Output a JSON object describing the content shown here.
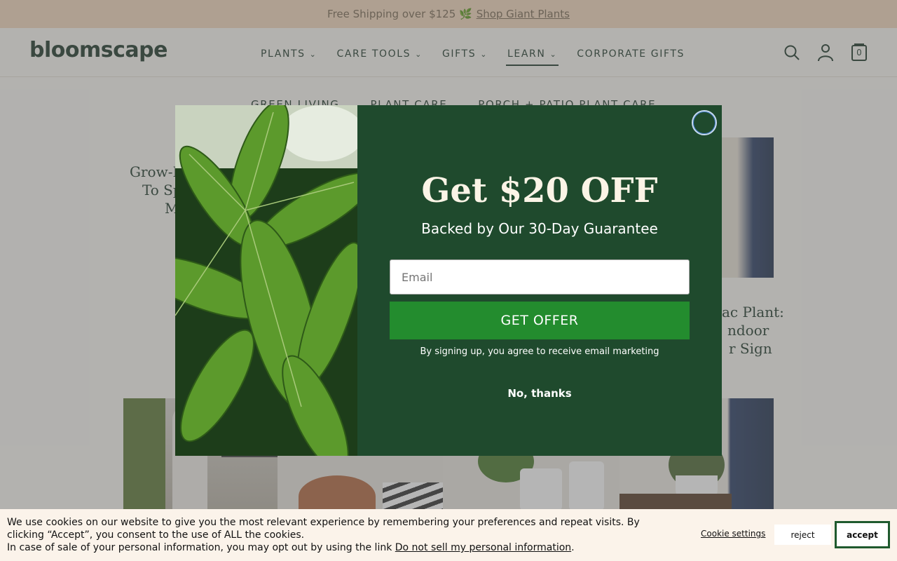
{
  "announcement": {
    "text": "Free Shipping over $125 🌿",
    "link": "Shop Giant Plants"
  },
  "header": {
    "logo": "bloomscape",
    "nav": [
      {
        "label": "PLANTS",
        "has_dropdown": true
      },
      {
        "label": "CARE TOOLS",
        "has_dropdown": true
      },
      {
        "label": "GIFTS",
        "has_dropdown": true
      },
      {
        "label": "LEARN",
        "has_dropdown": true,
        "active": true
      },
      {
        "label": "CORPORATE GIFTS",
        "has_dropdown": false
      }
    ],
    "icons": [
      "search-icon",
      "account-icon",
      "cart-icon"
    ],
    "cart_count": "0"
  },
  "subnav": [
    "GREEN LIVING",
    "PLANT CARE",
    "PORCH + PATIO PLANT CARE"
  ],
  "background": {
    "left_card_title_fragments": [
      "Grow-H",
      "To Sp",
      "M"
    ],
    "right_card_title_fragments": [
      "ac Plant:",
      "ndoor",
      "r Sign"
    ]
  },
  "modal": {
    "title": "Get $20 OFF",
    "subtitle": "Backed by Our 30-Day Guarantee",
    "email_placeholder": "Email",
    "cta": "GET OFFER",
    "disclaimer": "By signing up, you agree to receive email marketing",
    "dismiss": "No, thanks"
  },
  "cookie": {
    "line1": "We use cookies on our website to give you the most relevant experience by remembering your preferences and repeat visits. By clicking “Accept”, you consent to the use of ALL the cookies.",
    "line2_prefix": "In case of sale of your personal information, you may opt out by using the link",
    "line2_link": "Do not sell my personal information",
    "line2_suffix": ".",
    "settings": "Cookie settings",
    "reject": "reject",
    "accept": "accept"
  },
  "colors": {
    "brand_green": "#1f4a2d",
    "cta_green": "#238c2e",
    "announce_bg": "#f4d9bd",
    "page_bg": "#fbf9f4"
  }
}
